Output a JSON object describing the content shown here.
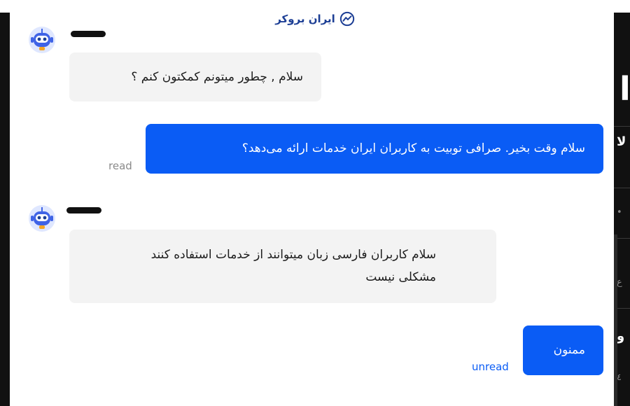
{
  "brand": {
    "name": "ایران بروکر",
    "logo_icon": "trend-chart-icon",
    "color": "#1d3f95"
  },
  "agent": {
    "name_redacted": true
  },
  "messages": [
    {
      "sender": "agent",
      "text": "سلام , چطور میتونم کمکتون کنم ؟"
    },
    {
      "sender": "user",
      "text": "سلام وقت بخیر. صرافی توبیت به کاربران ایران خدمات ارائه می‌دهد؟",
      "status": "read"
    },
    {
      "sender": "agent",
      "text_line1": "سلام کاربران فارسی زبان میتوانند از خدمات استفاده کنند",
      "text_line2": "مشکلی نیست"
    },
    {
      "sender": "user",
      "text": "ممنون",
      "status": "unread"
    }
  ],
  "colors": {
    "user_bubble": "#0a5cf5",
    "agent_bubble": "#f3f3f3",
    "read_status": "#8a8a8a",
    "unread_status": "#0a5cf5"
  }
}
